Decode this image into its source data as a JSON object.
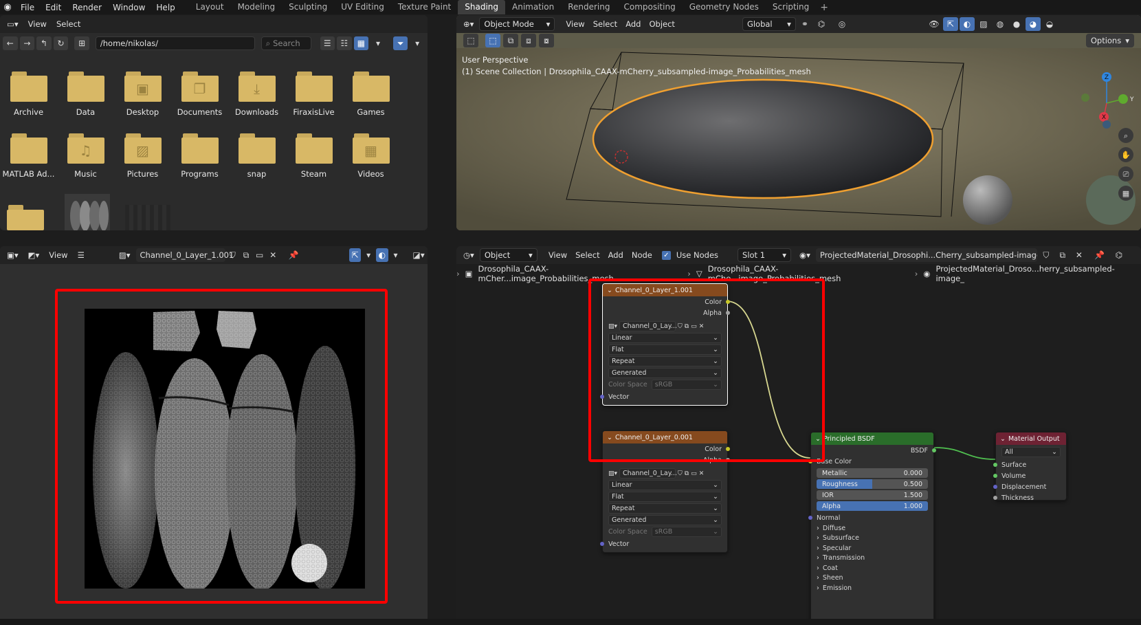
{
  "topbar": {
    "menus": [
      "File",
      "Edit",
      "Render",
      "Window",
      "Help"
    ],
    "workspaces": [
      "Layout",
      "Modeling",
      "Sculpting",
      "UV Editing",
      "Texture Paint",
      "Shading",
      "Animation",
      "Rendering",
      "Compositing",
      "Geometry Nodes",
      "Scripting"
    ],
    "active_workspace": "Shading"
  },
  "file_browser": {
    "menu_view": "View",
    "menu_select": "Select",
    "path": "/home/nikolas/",
    "search_placeholder": "Search",
    "folders": [
      {
        "name": "Archive",
        "glyph": ""
      },
      {
        "name": "Data",
        "glyph": ""
      },
      {
        "name": "Desktop",
        "glyph": "▣"
      },
      {
        "name": "Documents",
        "glyph": "❐"
      },
      {
        "name": "Downloads",
        "glyph": "⤓"
      },
      {
        "name": "FiraxisLive",
        "glyph": ""
      },
      {
        "name": "Games",
        "glyph": ""
      },
      {
        "name": "MATLAB Ad...",
        "glyph": ""
      },
      {
        "name": "Music",
        "glyph": "♫"
      },
      {
        "name": "Pictures",
        "glyph": "▨"
      },
      {
        "name": "Programs",
        "glyph": ""
      },
      {
        "name": "snap",
        "glyph": ""
      },
      {
        "name": "Steam",
        "glyph": ""
      },
      {
        "name": "Videos",
        "glyph": "▦"
      }
    ]
  },
  "viewport": {
    "mode": "Object Mode",
    "menus": [
      "View",
      "Select",
      "Add",
      "Object"
    ],
    "transform": "Global",
    "options": "Options",
    "perspective": "User Perspective",
    "collection": "(1) Scene Collection | Drosophila_CAAX-mCherry_subsampled-image_Probabilities_mesh",
    "gizmo": {
      "x": "X",
      "y": "Y",
      "z": "Z"
    }
  },
  "image_editor": {
    "menu_view": "View",
    "image_name": "Channel_0_Layer_1.001"
  },
  "node_editor": {
    "object_mode": "Object",
    "menus": [
      "View",
      "Select",
      "Add",
      "Node"
    ],
    "use_nodes": "Use Nodes",
    "slot": "Slot 1",
    "material": "ProjectedMaterial_Drosophi...Cherry_subsampled-image_",
    "breadcrumbs": [
      "Drosophila_CAAX-mCher...image_Probabilities_mesh",
      "Drosophila_CAAX-mChe...image_Probabilities_mesh",
      "ProjectedMaterial_Droso...herry_subsampled-image_"
    ],
    "tex_node_1": {
      "title": "Channel_0_Layer_1.001",
      "out_color": "Color",
      "out_alpha": "Alpha",
      "image": "Channel_0_Lay...",
      "interpolation": "Linear",
      "projection": "Flat",
      "extension": "Repeat",
      "source": "Generated",
      "color_space_label": "Color Space",
      "color_space": "sRGB",
      "in_vector": "Vector"
    },
    "tex_node_2": {
      "title": "Channel_0_Layer_0.001",
      "out_color": "Color",
      "out_alpha": "Alpha",
      "image": "Channel_0_Lay...",
      "interpolation": "Linear",
      "projection": "Flat",
      "extension": "Repeat",
      "source": "Generated",
      "color_space_label": "Color Space",
      "color_space": "sRGB",
      "in_vector": "Vector"
    },
    "bsdf": {
      "title": "Principled BSDF",
      "out": "BSDF",
      "base_color": "Base Color",
      "metallic": {
        "label": "Metallic",
        "value": "0.000",
        "fraction": 0.0
      },
      "roughness": {
        "label": "Roughness",
        "value": "0.500",
        "fraction": 0.5
      },
      "ior": {
        "label": "IOR",
        "value": "1.500",
        "fraction": 0.0
      },
      "alpha": {
        "label": "Alpha",
        "value": "1.000",
        "fraction": 1.0
      },
      "normal": "Normal",
      "panels": [
        "Diffuse",
        "Subsurface",
        "Specular",
        "Transmission",
        "Coat",
        "Sheen",
        "Emission"
      ]
    },
    "output": {
      "title": "Material Output",
      "target": "All",
      "inputs": [
        "Surface",
        "Volume",
        "Displacement",
        "Thickness"
      ]
    }
  }
}
